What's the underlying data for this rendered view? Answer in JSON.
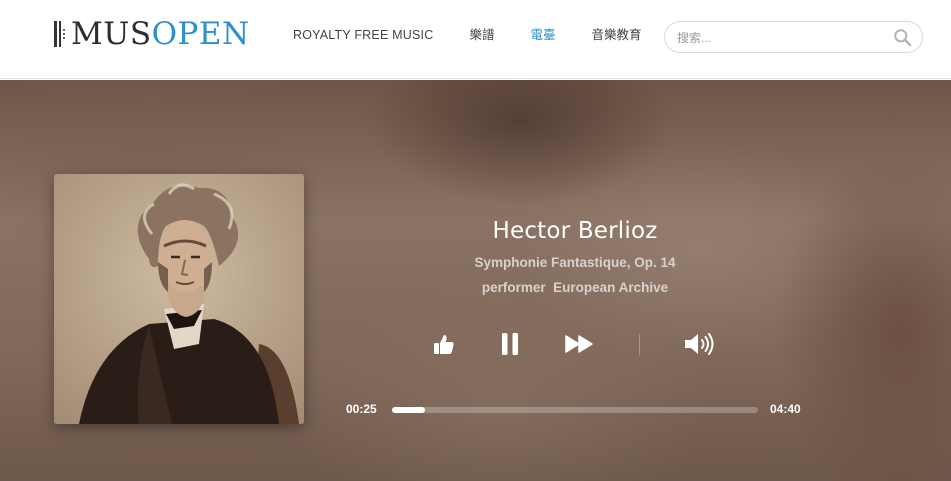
{
  "header": {
    "logo": {
      "part1": "MUS",
      "part2": "OPEN"
    },
    "nav": [
      {
        "label": "ROYALTY FREE MUSIC"
      },
      {
        "label": "樂譜"
      },
      {
        "label": "電臺",
        "active": true
      },
      {
        "label": "音樂教育"
      }
    ],
    "search": {
      "placeholder": "搜索...",
      "value": "",
      "icon": "search-icon"
    }
  },
  "player": {
    "cover_art": "composer-portrait-image",
    "composer": "Hector Berlioz",
    "work": "Symphonie Fantastique, Op. 14",
    "performer_line": "performer  European Archive",
    "controls": [
      {
        "name": "like",
        "icon": "thumbs-up-icon"
      },
      {
        "name": "pause",
        "icon": "pause-icon"
      },
      {
        "name": "skip",
        "icon": "fast-forward-icon"
      },
      {
        "name": "volume",
        "icon": "volume-icon"
      }
    ],
    "time_current": "00:25",
    "time_total": "04:40",
    "progress_fraction": 0.089
  },
  "colors": {
    "accent": "#2b8fd0",
    "text_dark": "#2d2d2d",
    "nav_text": "#444444",
    "player_bg": "#7f6759"
  }
}
